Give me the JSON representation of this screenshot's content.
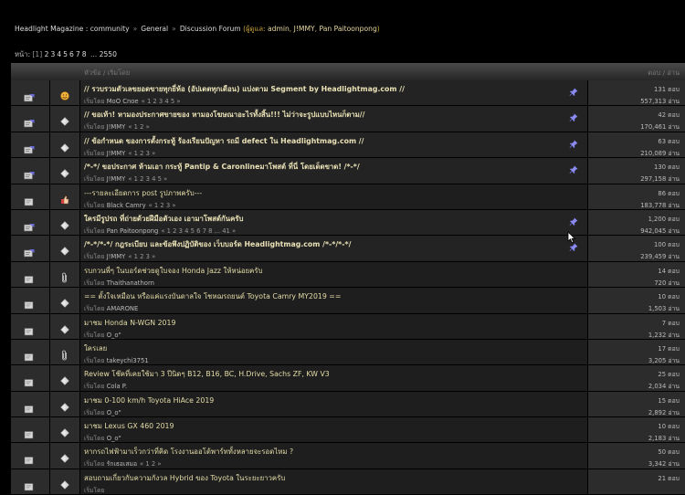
{
  "breadcrumb": {
    "site": "Headlight Magazine : community",
    "cat": "General",
    "forum": "Discussion Forum",
    "mods_label": "(ผู้ดูแล:",
    "mods": [
      "admin",
      "J!MMY",
      "Pan Paitoonpong"
    ],
    "mods_close": ")"
  },
  "pager": {
    "label": "หน้า:",
    "current": "[1]",
    "pages": [
      "2",
      "3",
      "4",
      "5",
      "6",
      "7",
      "8"
    ],
    "ellipsis": "...",
    "last": "2550"
  },
  "header": {
    "topic": "หัวข้อ / เริ่มโดย",
    "replies": "ตอบ / อ่าน"
  },
  "by_label": "เริ่มโดย",
  "topics": [
    {
      "title": "// รวบรวมตัวเลขยอดขายทุกยี่ห้อ (อัปเดตทุกเดือน) แบ่งตาม Segment by Headlightmag.com //",
      "author": "MoO Cnoe",
      "pages": "« 1 2 3 4 5 »",
      "replies": "131 ตอบ",
      "views": "557,313 อ่าน",
      "sticky": true,
      "topic_icon": "smiley"
    },
    {
      "title": "// ขอเท้า! หามองประกาศขายของ หามองโฆษณาอะไรทั้งสิ้น!!! ไม่ว่าจะรูปแบบไหนก็ตาม//",
      "author": "J!MMY",
      "pages": "« 1 2 »",
      "replies": "42 ตอบ",
      "views": "170,461 อ่าน",
      "sticky": true,
      "topic_icon": "diamond"
    },
    {
      "title": "// ข้อกำหนด ของการตั้งกระทู้ ร้องเรียนปัญหา รถมี defect ใน Headlightmag.com //",
      "author": "J!MMY",
      "pages": "« 1 2 3 »",
      "replies": "63 ตอบ",
      "views": "210,089 อ่าน",
      "sticky": true,
      "topic_icon": "diamond"
    },
    {
      "title": "/*-*/ ขอประกาศ ห้ามเอา กระทู้ Pantip & Caronlineมาโพสต์ ที่นี่ โดยเด็ดขาด! /*-*/",
      "author": "J!MMY",
      "pages": "« 1 2 3 4 5 »",
      "replies": "130 ตอบ",
      "views": "297,158 อ่าน",
      "sticky": true,
      "topic_icon": "diamond"
    },
    {
      "title": "---รายละเอียดการ post รูปภาพครับ---",
      "author": "Black Camry",
      "pages": "« 1 2 3 »",
      "replies": "86 ตอบ",
      "views": "183,778 อ่าน",
      "sticky": false,
      "topic_icon": "thumb"
    },
    {
      "title": "ใครมีรูปรถ ที่ถ่ายด้วยฝีมือตัวเอง เอามาโพสต์กันครับ",
      "author": "Pan Paitoonpong",
      "pages": "« 1 2 3 4 5 6 7 8 ... 41 »",
      "replies": "1,200 ตอบ",
      "views": "942,045 อ่าน",
      "sticky": true,
      "topic_icon": "diamond"
    },
    {
      "title": "/*-*/*-*/ กฎระเบียบ และข้อพึงปฏิบัติของ เว็บบอร์ด Headlightmag.com /*-*/*-*/",
      "author": "J!MMY",
      "pages": "« 1 2 3 »",
      "replies": "100 ตอบ",
      "views": "239,459 อ่าน",
      "sticky": true,
      "topic_icon": "diamond"
    },
    {
      "title": "รบกวนพี่ๆ ในบอร์ดช่วยดูใบจอง Honda Jazz ให้หน่อยครับ",
      "author": "Thaithanathorn",
      "pages": "",
      "replies": "14 ตอบ",
      "views": "720 อ่าน",
      "sticky": false,
      "topic_icon": "clip"
    },
    {
      "title": "== ตั้งใจเหมือน หรือแค่แรงบันดาลใจ โชหฌรถยนต์ Toyota Camry MY2019 ==",
      "author": "AMARONE",
      "pages": "",
      "replies": "10 ตอบ",
      "views": "1,503 อ่าน",
      "sticky": false,
      "topic_icon": "diamond"
    },
    {
      "title": "มาชม Honda N-WGN 2019",
      "author": "O_o\"",
      "pages": "",
      "replies": "7 ตอบ",
      "views": "1,232 อ่าน",
      "sticky": false,
      "topic_icon": "diamond"
    },
    {
      "title": "ใครเลย",
      "author": "takeychi3751",
      "pages": "",
      "replies": "17 ตอบ",
      "views": "3,205 อ่าน",
      "sticky": false,
      "topic_icon": "clip"
    },
    {
      "title": "Review โช๊คที่เคยใช้มา 3 ปีนิดๆ B12, B16, BC, H.Drive, Sachs ZF, KW V3",
      "author": "Cola P.",
      "pages": "",
      "replies": "25 ตอบ",
      "views": "2,034 อ่าน",
      "sticky": false,
      "topic_icon": "diamond"
    },
    {
      "title": "มาชม 0-100 km/h Toyota HiAce 2019",
      "author": "O_o\"",
      "pages": "",
      "replies": "15 ตอบ",
      "views": "2,892 อ่าน",
      "sticky": false,
      "topic_icon": "diamond"
    },
    {
      "title": "มาชม Lexus GX 460 2019",
      "author": "O_o\"",
      "pages": "",
      "replies": "10 ตอบ",
      "views": "2,183 อ่าน",
      "sticky": false,
      "topic_icon": "diamond"
    },
    {
      "title": "หากรถไฟฟ้ามาเร็วกว่าที่คิด โรงงานออโต้พาร์ททั้งหลายจะรอดไหม ?",
      "author": "รักเธอเสมอ",
      "pages": "« 1 2 »",
      "replies": "50 ตอบ",
      "views": "3,342 อ่าน",
      "sticky": false,
      "topic_icon": "diamond"
    },
    {
      "title": "สอบถามเกี่ยวกับความกังวล Hybrid ของ Toyota ในระยะยาวครับ",
      "author": "",
      "pages": "",
      "replies": "21 ตอบ",
      "views": "",
      "sticky": false,
      "topic_icon": "diamond"
    }
  ],
  "colors": {
    "title": "#e9e1b5",
    "moderator": "#c9a23a"
  }
}
